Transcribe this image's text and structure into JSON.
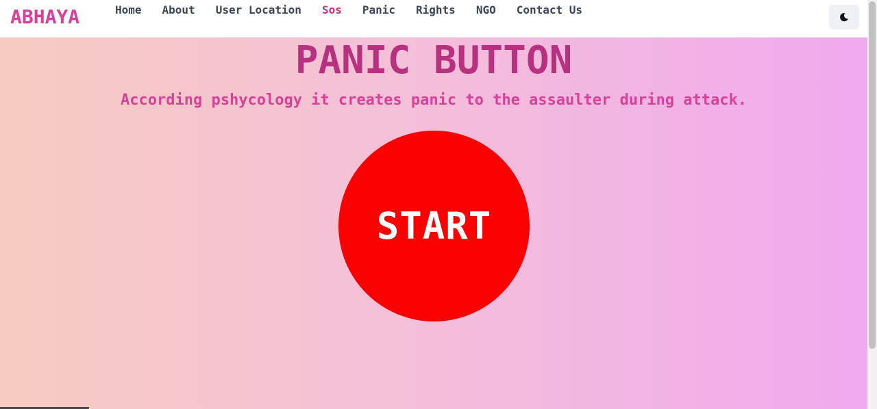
{
  "navbar": {
    "brand": "ABHAYA",
    "links": [
      {
        "label": "Home",
        "active": false
      },
      {
        "label": "About",
        "active": false
      },
      {
        "label": "User Location",
        "active": false
      },
      {
        "label": "Sos",
        "active": true
      },
      {
        "label": "Panic",
        "active": false
      },
      {
        "label": "Rights",
        "active": false
      },
      {
        "label": "NGO",
        "active": false
      },
      {
        "label": "Contact Us",
        "active": false
      }
    ],
    "theme_toggle_icon": "moon-icon"
  },
  "hero": {
    "title": "PANIC BUTTON",
    "subtitle": "According pshycology it creates panic to the assaulter during attack.",
    "start_button_label": "START"
  },
  "colors": {
    "brand": "#d9409a",
    "title": "#b83181",
    "active_link": "#c8307f",
    "nav_text": "#3b4556",
    "start_button": "#fb0000",
    "gradient_start": "#f7cbc1",
    "gradient_end": "#f0a9ee"
  }
}
